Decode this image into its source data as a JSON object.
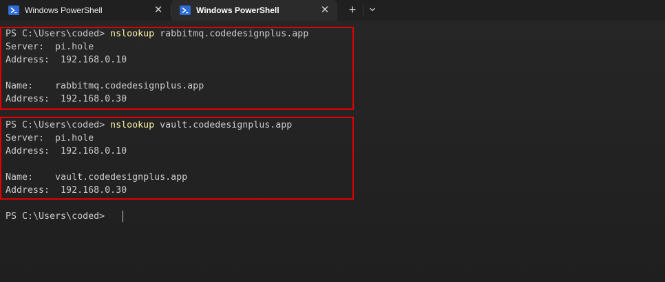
{
  "tabs": [
    {
      "label": "Windows PowerShell",
      "icon": "powershell-icon",
      "active": false
    },
    {
      "label": "Windows PowerShell",
      "icon": "powershell-icon",
      "active": true
    }
  ],
  "tabbar": {
    "close_glyph": "✕",
    "new_tab_glyph": "+",
    "dropdown_icon": "chevron-down-icon"
  },
  "terminal": {
    "block1": {
      "prompt": "PS C:\\Users\\coded> ",
      "command": "nslookup",
      "argument": " rabbitmq.codedesignplus.app",
      "server_line": "Server:  pi.hole",
      "address1_line": "Address:  192.168.0.10",
      "name_line": "Name:    rabbitmq.codedesignplus.app",
      "address2_line": "Address:  192.168.0.30"
    },
    "block2": {
      "prompt": "PS C:\\Users\\coded> ",
      "command": "nslookup",
      "argument": " vault.codedesignplus.app",
      "server_line": "Server:  pi.hole",
      "address1_line": "Address:  192.168.0.10",
      "name_line": "Name:    vault.codedesignplus.app",
      "address2_line": "Address:  192.168.0.30"
    },
    "final_prompt": "PS C:\\Users\\coded> "
  },
  "colors": {
    "highlight_box": "#e00000",
    "command": "#f9f1a5",
    "text": "#cccccc",
    "powershell_icon": "#2d6bd6"
  }
}
